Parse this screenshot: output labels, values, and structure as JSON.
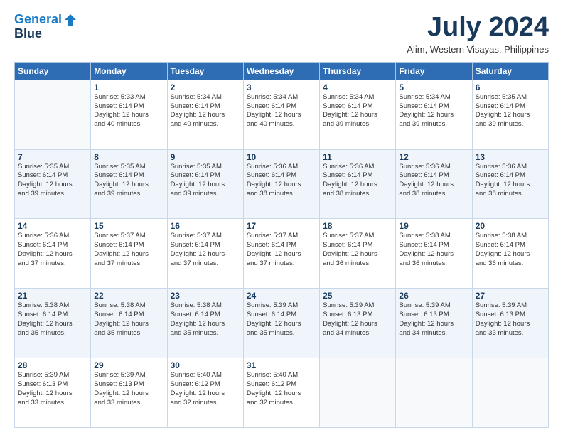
{
  "header": {
    "logo_line1": "General",
    "logo_line2": "Blue",
    "month_title": "July 2024",
    "subtitle": "Alim, Western Visayas, Philippines"
  },
  "days_of_week": [
    "Sunday",
    "Monday",
    "Tuesday",
    "Wednesday",
    "Thursday",
    "Friday",
    "Saturday"
  ],
  "weeks": [
    [
      {
        "day": "",
        "info": ""
      },
      {
        "day": "1",
        "info": "Sunrise: 5:33 AM\nSunset: 6:14 PM\nDaylight: 12 hours\nand 40 minutes."
      },
      {
        "day": "2",
        "info": "Sunrise: 5:34 AM\nSunset: 6:14 PM\nDaylight: 12 hours\nand 40 minutes."
      },
      {
        "day": "3",
        "info": "Sunrise: 5:34 AM\nSunset: 6:14 PM\nDaylight: 12 hours\nand 40 minutes."
      },
      {
        "day": "4",
        "info": "Sunrise: 5:34 AM\nSunset: 6:14 PM\nDaylight: 12 hours\nand 39 minutes."
      },
      {
        "day": "5",
        "info": "Sunrise: 5:34 AM\nSunset: 6:14 PM\nDaylight: 12 hours\nand 39 minutes."
      },
      {
        "day": "6",
        "info": "Sunrise: 5:35 AM\nSunset: 6:14 PM\nDaylight: 12 hours\nand 39 minutes."
      }
    ],
    [
      {
        "day": "7",
        "info": "Sunrise: 5:35 AM\nSunset: 6:14 PM\nDaylight: 12 hours\nand 39 minutes."
      },
      {
        "day": "8",
        "info": "Sunrise: 5:35 AM\nSunset: 6:14 PM\nDaylight: 12 hours\nand 39 minutes."
      },
      {
        "day": "9",
        "info": "Sunrise: 5:35 AM\nSunset: 6:14 PM\nDaylight: 12 hours\nand 39 minutes."
      },
      {
        "day": "10",
        "info": "Sunrise: 5:36 AM\nSunset: 6:14 PM\nDaylight: 12 hours\nand 38 minutes."
      },
      {
        "day": "11",
        "info": "Sunrise: 5:36 AM\nSunset: 6:14 PM\nDaylight: 12 hours\nand 38 minutes."
      },
      {
        "day": "12",
        "info": "Sunrise: 5:36 AM\nSunset: 6:14 PM\nDaylight: 12 hours\nand 38 minutes."
      },
      {
        "day": "13",
        "info": "Sunrise: 5:36 AM\nSunset: 6:14 PM\nDaylight: 12 hours\nand 38 minutes."
      }
    ],
    [
      {
        "day": "14",
        "info": "Sunrise: 5:36 AM\nSunset: 6:14 PM\nDaylight: 12 hours\nand 37 minutes."
      },
      {
        "day": "15",
        "info": "Sunrise: 5:37 AM\nSunset: 6:14 PM\nDaylight: 12 hours\nand 37 minutes."
      },
      {
        "day": "16",
        "info": "Sunrise: 5:37 AM\nSunset: 6:14 PM\nDaylight: 12 hours\nand 37 minutes."
      },
      {
        "day": "17",
        "info": "Sunrise: 5:37 AM\nSunset: 6:14 PM\nDaylight: 12 hours\nand 37 minutes."
      },
      {
        "day": "18",
        "info": "Sunrise: 5:37 AM\nSunset: 6:14 PM\nDaylight: 12 hours\nand 36 minutes."
      },
      {
        "day": "19",
        "info": "Sunrise: 5:38 AM\nSunset: 6:14 PM\nDaylight: 12 hours\nand 36 minutes."
      },
      {
        "day": "20",
        "info": "Sunrise: 5:38 AM\nSunset: 6:14 PM\nDaylight: 12 hours\nand 36 minutes."
      }
    ],
    [
      {
        "day": "21",
        "info": "Sunrise: 5:38 AM\nSunset: 6:14 PM\nDaylight: 12 hours\nand 35 minutes."
      },
      {
        "day": "22",
        "info": "Sunrise: 5:38 AM\nSunset: 6:14 PM\nDaylight: 12 hours\nand 35 minutes."
      },
      {
        "day": "23",
        "info": "Sunrise: 5:38 AM\nSunset: 6:14 PM\nDaylight: 12 hours\nand 35 minutes."
      },
      {
        "day": "24",
        "info": "Sunrise: 5:39 AM\nSunset: 6:14 PM\nDaylight: 12 hours\nand 35 minutes."
      },
      {
        "day": "25",
        "info": "Sunrise: 5:39 AM\nSunset: 6:13 PM\nDaylight: 12 hours\nand 34 minutes."
      },
      {
        "day": "26",
        "info": "Sunrise: 5:39 AM\nSunset: 6:13 PM\nDaylight: 12 hours\nand 34 minutes."
      },
      {
        "day": "27",
        "info": "Sunrise: 5:39 AM\nSunset: 6:13 PM\nDaylight: 12 hours\nand 33 minutes."
      }
    ],
    [
      {
        "day": "28",
        "info": "Sunrise: 5:39 AM\nSunset: 6:13 PM\nDaylight: 12 hours\nand 33 minutes."
      },
      {
        "day": "29",
        "info": "Sunrise: 5:39 AM\nSunset: 6:13 PM\nDaylight: 12 hours\nand 33 minutes."
      },
      {
        "day": "30",
        "info": "Sunrise: 5:40 AM\nSunset: 6:12 PM\nDaylight: 12 hours\nand 32 minutes."
      },
      {
        "day": "31",
        "info": "Sunrise: 5:40 AM\nSunset: 6:12 PM\nDaylight: 12 hours\nand 32 minutes."
      },
      {
        "day": "",
        "info": ""
      },
      {
        "day": "",
        "info": ""
      },
      {
        "day": "",
        "info": ""
      }
    ]
  ]
}
